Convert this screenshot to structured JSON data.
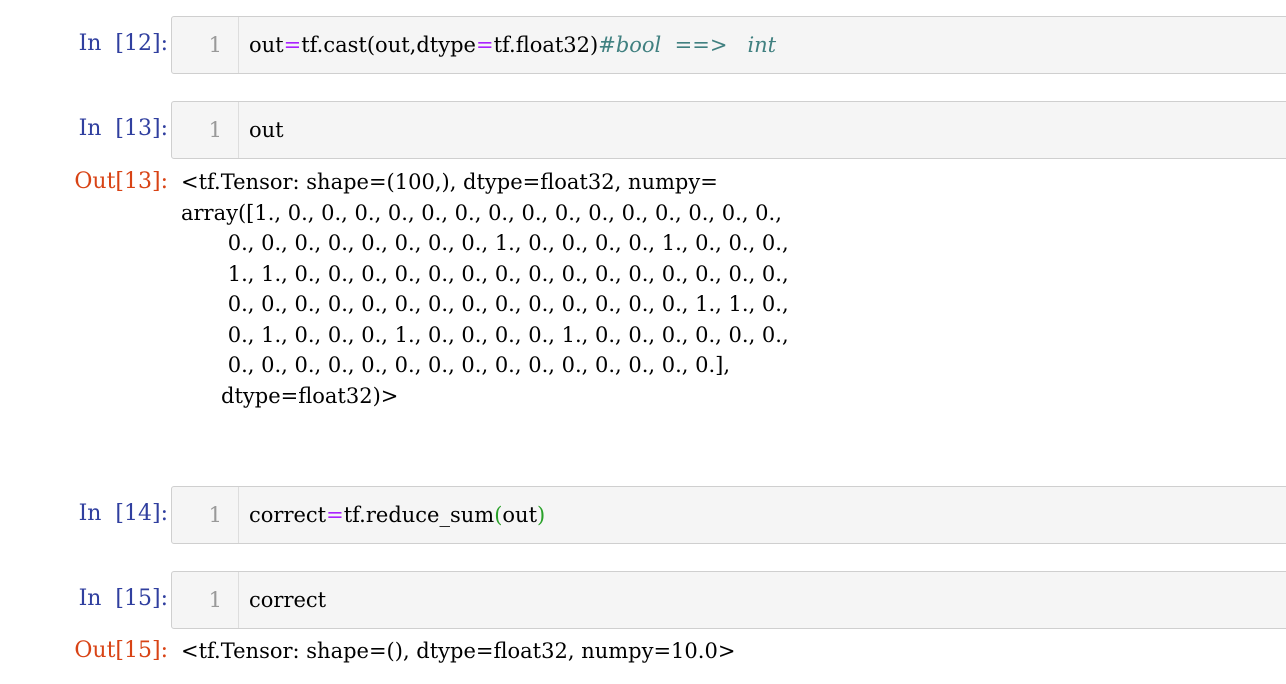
{
  "cells": [
    {
      "in_prompt": "In  [12]:",
      "line_number": "1",
      "code": {
        "part1": "out",
        "op1": "=",
        "part2": "tf.cast(out,dtype",
        "op2": "=",
        "part3": "tf.float32)",
        "comment": "#bool  ==>   int"
      }
    },
    {
      "in_prompt": "In  [13]:",
      "line_number": "1",
      "code": "out",
      "out_prompt": "Out[13]:",
      "output_lines": [
        "<tf.Tensor: shape=(100,), dtype=float32, numpy=",
        "array([1., 0., 0., 0., 0., 0., 0., 0., 0., 0., 0., 0., 0., 0., 0., 0.,",
        "       0., 0., 0., 0., 0., 0., 0., 0., 1., 0., 0., 0., 0., 1., 0., 0., 0.,",
        "       1., 1., 0., 0., 0., 0., 0., 0., 0., 0., 0., 0., 0., 0., 0., 0., 0.,",
        "       0., 0., 0., 0., 0., 0., 0., 0., 0., 0., 0., 0., 0., 0., 1., 1., 0.,",
        "       0., 1., 0., 0., 0., 1., 0., 0., 0., 0., 1., 0., 0., 0., 0., 0., 0.,",
        "       0., 0., 0., 0., 0., 0., 0., 0., 0., 0., 0., 0., 0., 0., 0.],",
        "      dtype=float32)>"
      ]
    },
    {
      "in_prompt": "In  [14]:",
      "line_number": "1",
      "code": {
        "part1": "correct",
        "op1": "=",
        "part2": "tf.reduce_sum",
        "paren_open": "(",
        "part3": "out",
        "paren_close": ")"
      }
    },
    {
      "in_prompt": "In  [15]:",
      "line_number": "1",
      "code": "correct",
      "out_prompt": "Out[15]:",
      "output_lines": [
        "<tf.Tensor: shape=(), dtype=float32, numpy=10.0>"
      ]
    }
  ],
  "colors": {
    "in_prompt": "#303f9f",
    "out_prompt": "#d84315",
    "operator": "#aa22ff",
    "comment": "#408080",
    "paren": "#2aa12a"
  }
}
